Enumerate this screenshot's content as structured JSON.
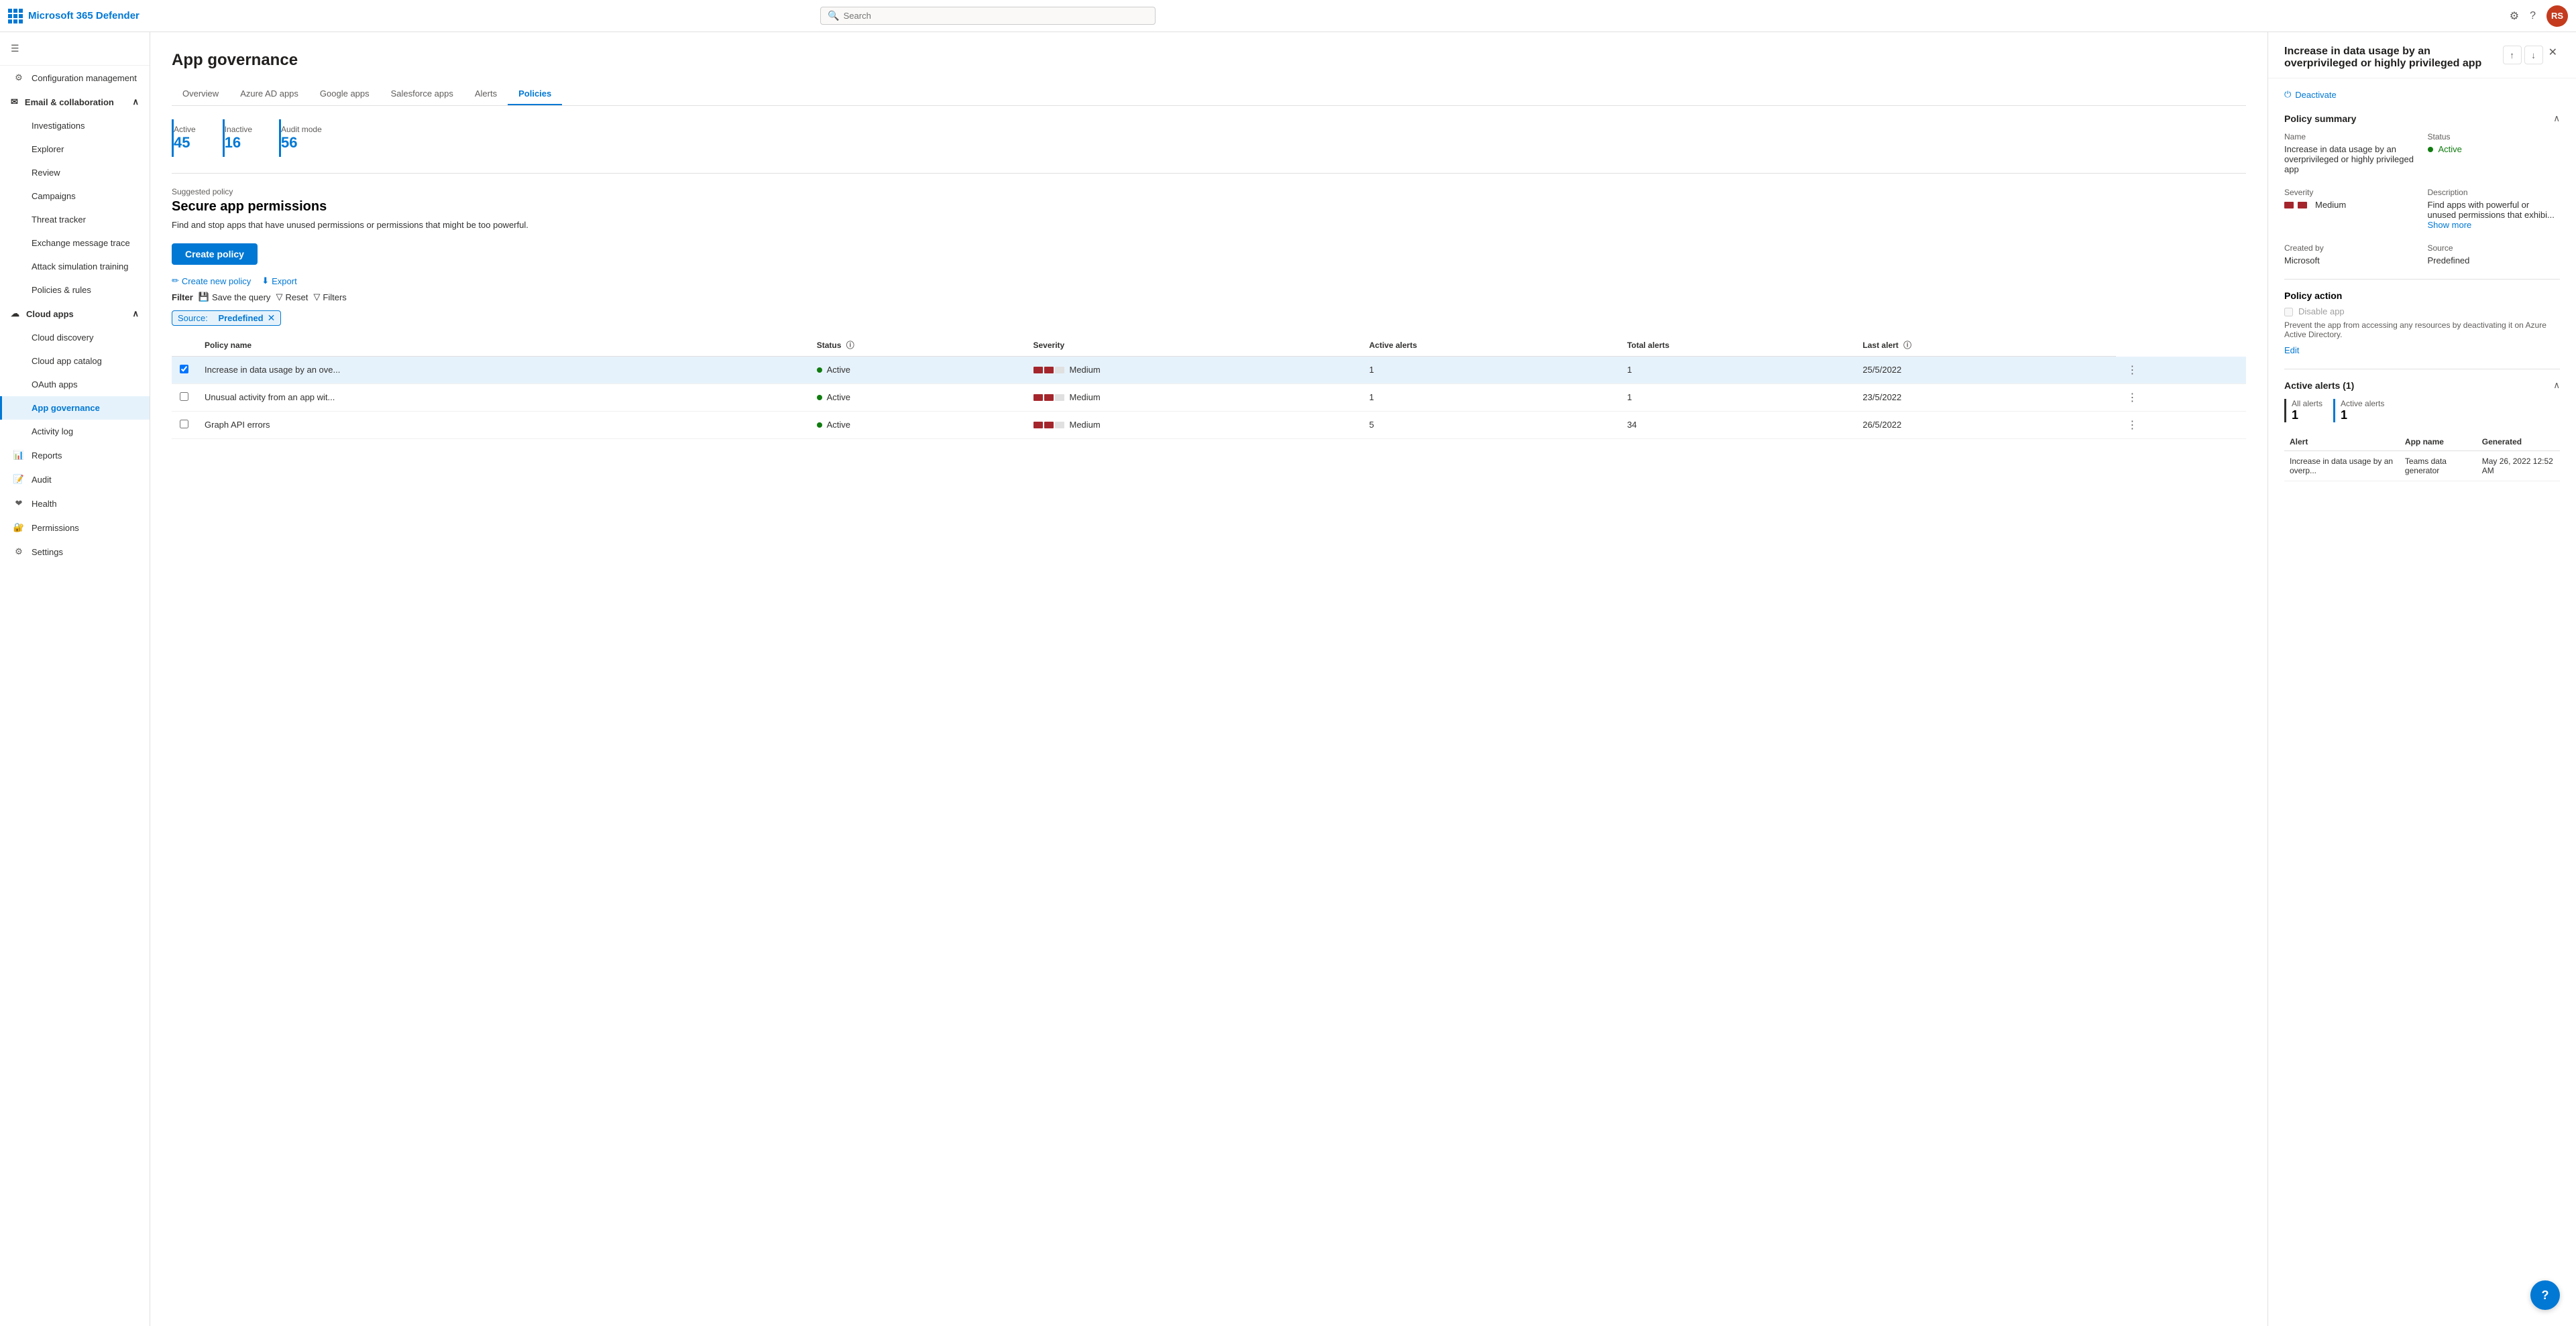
{
  "app": {
    "title": "Microsoft 365 Defender",
    "search_placeholder": "Search"
  },
  "topbar": {
    "logo_text": "Microsoft 365 Defender",
    "settings_icon": "⚙",
    "help_icon": "?",
    "avatar_initials": "RS"
  },
  "sidebar": {
    "hamburger_icon": "☰",
    "sections": [
      {
        "id": "config",
        "label": "Configuration management",
        "icon": "⚙",
        "type": "item"
      },
      {
        "id": "email-collab",
        "label": "Email & collaboration",
        "icon": "✉",
        "type": "section",
        "expanded": true,
        "children": [
          {
            "id": "investigations",
            "label": "Investigations",
            "icon": "🔍"
          },
          {
            "id": "explorer",
            "label": "Explorer",
            "icon": "📊"
          },
          {
            "id": "review",
            "label": "Review",
            "icon": "📋"
          },
          {
            "id": "campaigns",
            "label": "Campaigns",
            "icon": "🚩"
          },
          {
            "id": "threat-tracker",
            "label": "Threat tracker",
            "icon": "📌"
          },
          {
            "id": "exchange-msg",
            "label": "Exchange message trace",
            "icon": "📨"
          },
          {
            "id": "attack-sim",
            "label": "Attack simulation training",
            "icon": "🎯"
          },
          {
            "id": "policies-rules",
            "label": "Policies & rules",
            "icon": "📃"
          }
        ]
      },
      {
        "id": "cloud-apps",
        "label": "Cloud apps",
        "icon": "☁",
        "type": "section",
        "expanded": true,
        "children": [
          {
            "id": "cloud-discovery",
            "label": "Cloud discovery",
            "icon": "🔭"
          },
          {
            "id": "cloud-app-catalog",
            "label": "Cloud app catalog",
            "icon": "📚"
          },
          {
            "id": "oauth-apps",
            "label": "OAuth apps",
            "icon": "🔑"
          },
          {
            "id": "app-governance",
            "label": "App governance",
            "icon": "🛡",
            "active": true
          },
          {
            "id": "activity-log",
            "label": "Activity log",
            "icon": "📋"
          }
        ]
      },
      {
        "id": "reports",
        "label": "Reports",
        "icon": "📊",
        "type": "item"
      },
      {
        "id": "audit",
        "label": "Audit",
        "icon": "📝",
        "type": "item"
      },
      {
        "id": "health",
        "label": "Health",
        "icon": "❤",
        "type": "item"
      },
      {
        "id": "permissions",
        "label": "Permissions",
        "icon": "🔐",
        "type": "item"
      },
      {
        "id": "settings",
        "label": "Settings",
        "icon": "⚙",
        "type": "item"
      }
    ]
  },
  "main": {
    "page_title": "App governance",
    "tabs": [
      {
        "id": "overview",
        "label": "Overview"
      },
      {
        "id": "azure-ad",
        "label": "Azure AD apps"
      },
      {
        "id": "google-apps",
        "label": "Google apps"
      },
      {
        "id": "salesforce",
        "label": "Salesforce apps"
      },
      {
        "id": "alerts",
        "label": "Alerts"
      },
      {
        "id": "policies",
        "label": "Policies",
        "active": true
      }
    ],
    "stats": [
      {
        "label": "Active",
        "value": "45"
      },
      {
        "label": "Inactive",
        "value": "16"
      },
      {
        "label": "Audit mode",
        "value": "56"
      }
    ],
    "suggested_policy": {
      "label": "Suggested policy",
      "title": "Secure app permissions",
      "description": "Find and stop apps that have unused permissions or permissions that might be too powerful."
    },
    "create_policy_btn": "Create policy",
    "toolbar": {
      "create_new_policy": "Create new policy",
      "export": "Export",
      "filter_label": "Filter",
      "save_query": "Save the query",
      "reset": "Reset",
      "filters": "Filters"
    },
    "filter_tag": {
      "prefix": "Source:",
      "value": "Predefined"
    },
    "table": {
      "columns": [
        {
          "id": "name",
          "label": "Policy name"
        },
        {
          "id": "status",
          "label": "Status"
        },
        {
          "id": "severity",
          "label": "Severity"
        },
        {
          "id": "active-alerts",
          "label": "Active alerts"
        },
        {
          "id": "total-alerts",
          "label": "Total alerts"
        },
        {
          "id": "last-alert",
          "label": "Last alert"
        }
      ],
      "rows": [
        {
          "id": "row1",
          "selected": true,
          "name": "Increase in data usage by an ove...",
          "status": "Active",
          "severity": "Medium",
          "active_alerts": "1",
          "total_alerts": "1",
          "last_alert": "25/5/2022"
        },
        {
          "id": "row2",
          "selected": false,
          "name": "Unusual activity from an app wit...",
          "status": "Active",
          "severity": "Medium",
          "active_alerts": "1",
          "total_alerts": "1",
          "last_alert": "23/5/2022"
        },
        {
          "id": "row3",
          "selected": false,
          "name": "Graph API errors",
          "status": "Active",
          "severity": "Medium",
          "active_alerts": "5",
          "total_alerts": "34",
          "last_alert": "26/5/2022"
        }
      ]
    }
  },
  "panel": {
    "title": "Increase in data usage by an overprivileged or highly privileged app",
    "deactivate_btn": "Deactivate",
    "section_summary": "Policy summary",
    "name_label": "Name",
    "name_value": "Increase in data usage by an overprivileged or highly privileged app",
    "status_label": "Status",
    "status_value": "Active",
    "severity_label": "Severity",
    "severity_value": "Medium",
    "description_label": "Description",
    "description_value": "Find apps with powerful or unused permissions that exhibi...",
    "show_more": "Show more",
    "created_by_label": "Created by",
    "created_by_value": "Microsoft",
    "source_label": "Source",
    "source_value": "Predefined",
    "policy_action_label": "Policy action",
    "disable_app_label": "Disable app",
    "prevent_text": "Prevent the app from accessing any resources by deactivating it on Azure Active Directory.",
    "edit_link": "Edit",
    "alerts_section": "Active alerts (1)",
    "all_alerts_label": "All alerts",
    "all_alerts_value": "1",
    "active_alerts_label": "Active alerts",
    "active_alerts_value": "1",
    "alerts_table": {
      "columns": [
        "Alert",
        "App name",
        "Generated"
      ],
      "rows": [
        {
          "alert": "Increase in data usage by an overp...",
          "app_name": "Teams data generator",
          "generated": "May 26, 2022 12:52 AM"
        }
      ]
    }
  },
  "icons": {
    "search": "🔍",
    "up_arrow": "↑",
    "down_arrow": "↓",
    "close": "✕",
    "gear": "⚙",
    "help": "?",
    "deactivate": "⏻",
    "chevron_up": "∧",
    "chevron_down": "∨",
    "pencil": "✏",
    "export": "⬇",
    "filter": "▽",
    "save": "💾"
  }
}
